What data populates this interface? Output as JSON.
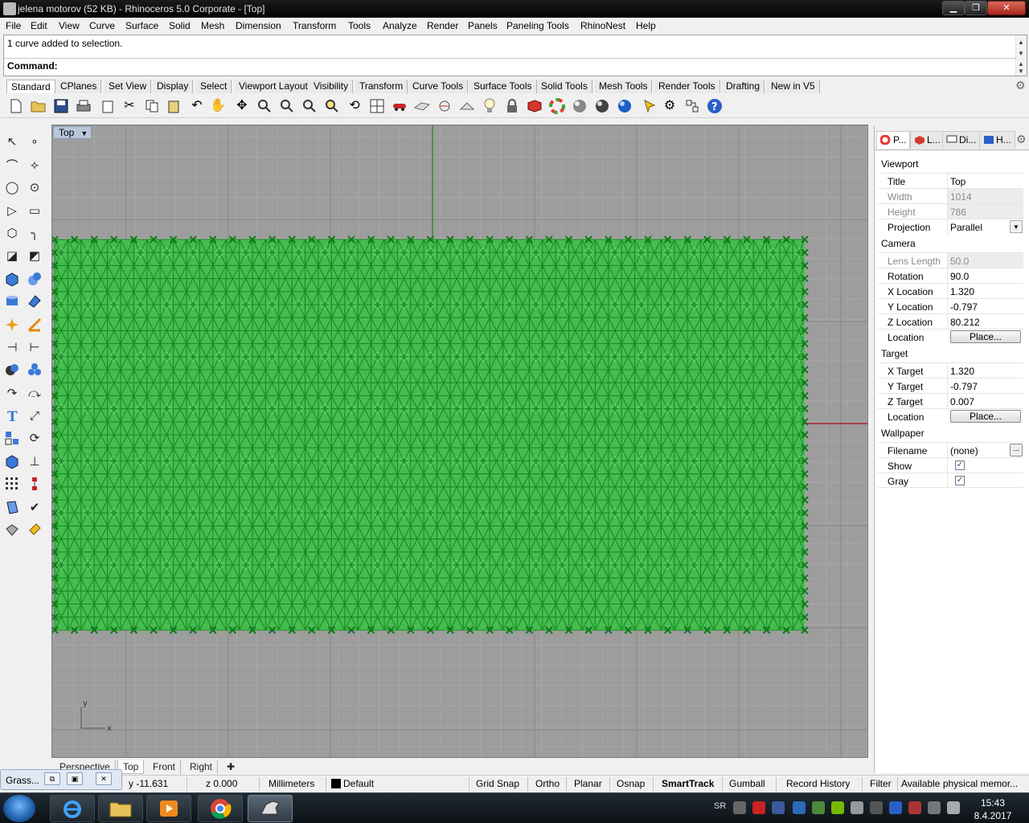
{
  "window": {
    "title": "jelena motorov (52 KB) - Rhinoceros  5.0 Corporate - [Top]"
  },
  "menu": [
    "File",
    "Edit",
    "View",
    "Curve",
    "Surface",
    "Solid",
    "Mesh",
    "Dimension",
    "Transform",
    "Tools",
    "Analyze",
    "Render",
    "Panels",
    "Paneling Tools",
    "RhinoNest",
    "Help"
  ],
  "command": {
    "history": "1 curve added to selection.",
    "prompt": "Command:",
    "value": ""
  },
  "toolbar_tabs": [
    "Standard",
    "CPlanes",
    "Set View",
    "Display",
    "Select",
    "Viewport Layout",
    "Visibility",
    "Transform",
    "Curve Tools",
    "Surface Tools",
    "Solid Tools",
    "Mesh Tools",
    "Render Tools",
    "Drafting",
    "New in V5"
  ],
  "toolbar_icons": [
    "new-file-icon",
    "open-folder-icon",
    "save-icon",
    "print-icon",
    "import-icon",
    "cut-icon",
    "copy-icon",
    "paste-icon",
    "undo-icon",
    "pan-hand-icon",
    "move-view-icon",
    "zoom-icon",
    "zoom-window-icon",
    "zoom-extents-icon",
    "zoom-selected-icon",
    "rotate-view-icon",
    "four-viewports-icon",
    "car-icon",
    "cplane-icon",
    "snap-icon",
    "lightbulb-icon",
    "lock-icon",
    "material-icon",
    "color-wheel-icon",
    "shaded-sphere-icon",
    "rendered-sphere-icon",
    "render-sphere-icon",
    "pointer-flag-icon",
    "options-gear-icon",
    "script-icon",
    "help-icon"
  ],
  "left_tools": [
    "select-icon",
    "point-icon",
    "polyline-icon",
    "curve-icon",
    "circle-icon",
    "ellipse-icon",
    "arc-icon",
    "rectangle-icon",
    "polygon-icon",
    "fillet-curve-icon",
    "surface-icon",
    "loft-icon",
    "box-icon",
    "sphere-icon",
    "cylinder-icon",
    "surface-edit-icon",
    "explode-icon",
    "trim-icon",
    "split-icon",
    "join-icon",
    "boolean-icon",
    "group-icon",
    "offset-icon",
    "blend-icon",
    "text-icon",
    "scale-icon",
    "array-icon",
    "rotate-icon",
    "mesh-icon",
    "dimension-icon",
    "grid-icon",
    "align-icon",
    "bend-icon",
    "check-icon",
    "analyze-icon",
    "paint-icon"
  ],
  "viewport": {
    "title": "Top",
    "tabs": [
      "Perspective",
      "Top",
      "Front",
      "Right"
    ],
    "active_tab": "Top",
    "axis_x": "x",
    "axis_y": "y"
  },
  "panel": {
    "tabs": [
      "P...",
      "L...",
      "Di...",
      "H..."
    ],
    "sections": {
      "viewport": "Viewport",
      "camera": "Camera",
      "target": "Target",
      "wallpaper": "Wallpaper"
    },
    "title_label": "Title",
    "title_value": "Top",
    "width_label": "Width",
    "width_value": "1014",
    "height_label": "Height",
    "height_value": "786",
    "projection_label": "Projection",
    "projection_value": "Parallel",
    "lens_label": "Lens Length",
    "lens_value": "50.0",
    "rotation_label": "Rotation",
    "rotation_value": "90.0",
    "xloc_label": "X Location",
    "xloc_value": "1.320",
    "yloc_label": "Y Location",
    "yloc_value": "-0.797",
    "zloc_label": "Z Location",
    "zloc_value": "80.212",
    "location_label": "Location",
    "place_label": "Place...",
    "xtar_label": "X Target",
    "xtar_value": "1.320",
    "ytar_label": "Y Target",
    "ytar_value": "-0.797",
    "ztar_label": "Z Target",
    "ztar_value": "0.007",
    "filename_label": "Filename",
    "filename_value": "(none)",
    "show_label": "Show",
    "gray_label": "Gray",
    "dots": "..."
  },
  "status": {
    "grass_label": "Grass...",
    "y": "y -11.631",
    "z": "z 0.000",
    "units": "Millimeters",
    "layer": "Default",
    "grid_snap": "Grid Snap",
    "ortho": "Ortho",
    "planar": "Planar",
    "osnap": "Osnap",
    "smarttrack": "SmartTrack",
    "gumball": "Gumball",
    "record_history": "Record History",
    "filter": "Filter",
    "memory": "Available physical memor..."
  },
  "taskbar": {
    "lang": "SR",
    "time": "15:43",
    "date": "8.4.2017"
  }
}
